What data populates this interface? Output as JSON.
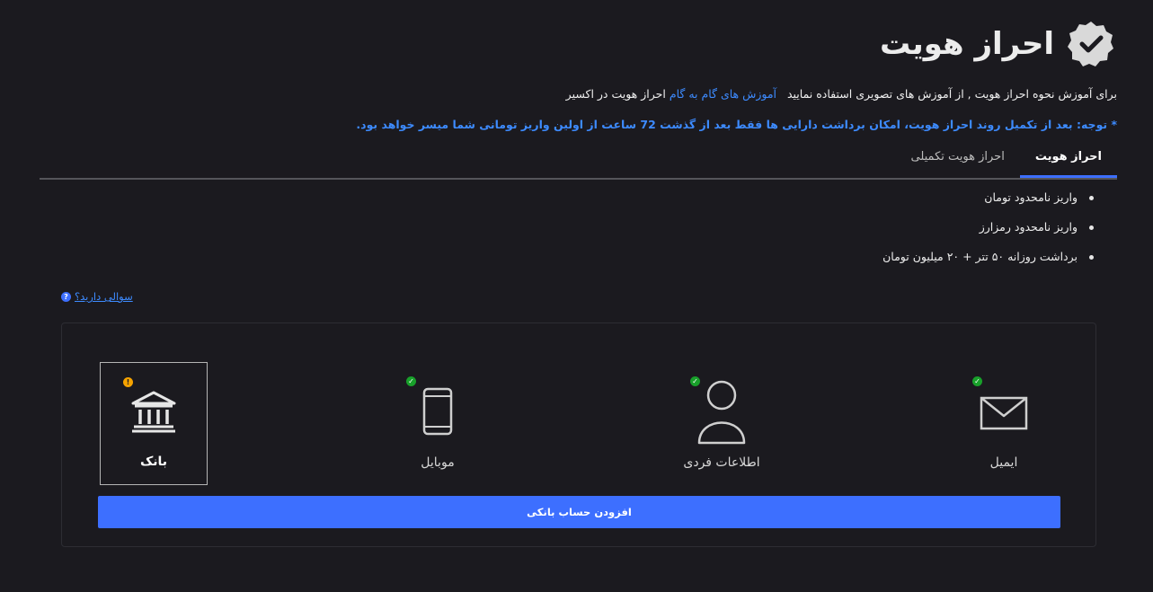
{
  "header": {
    "title": "احراز هویت",
    "icon": "verified-badge-icon"
  },
  "intro": {
    "text_before": "برای آموزش نحوه احراز هویت , از آموزش های تصویری استفاده نمایید",
    "link": "آموزش های گام به گام",
    "text_after": "احراز هویت در اکسیر"
  },
  "notice": "* توجه: بعد از تکمیل روند احراز هویت، امکان برداشت دارایی ها فقط بعد از گذشت 72 ساعت از اولین واریز تومانی شما میسر خواهد بود.",
  "tabs": [
    {
      "label": "احراز هویت",
      "active": true
    },
    {
      "label": "احراز هویت تکمیلی",
      "active": false
    }
  ],
  "features": [
    "واریز نامحدود تومان",
    "واریز نامحدود رمزارز",
    "برداشت روزانه ۵۰ تتر + ۲۰ میلیون تومان"
  ],
  "help": {
    "question": "سوالی دارید؟",
    "icon": "?"
  },
  "steps": [
    {
      "label": "ایمیل",
      "icon": "envelope-icon",
      "status": "verified"
    },
    {
      "label": "اطلاعات فردی",
      "icon": "user-icon",
      "status": "verified"
    },
    {
      "label": "موبایل",
      "icon": "mobile-icon",
      "status": "verified"
    },
    {
      "label": "بانک",
      "icon": "bank-icon",
      "status": "pending",
      "selected": true
    }
  ],
  "status_glyphs": {
    "ok": "✓",
    "warn": "!"
  },
  "action": {
    "add_bank_label": "افزودن حساب بانکی"
  },
  "colors": {
    "background": "#1b1a1f",
    "accent": "#3d6fff",
    "link": "#3d8bff",
    "success": "#18a02a",
    "warning": "#f5a300"
  }
}
